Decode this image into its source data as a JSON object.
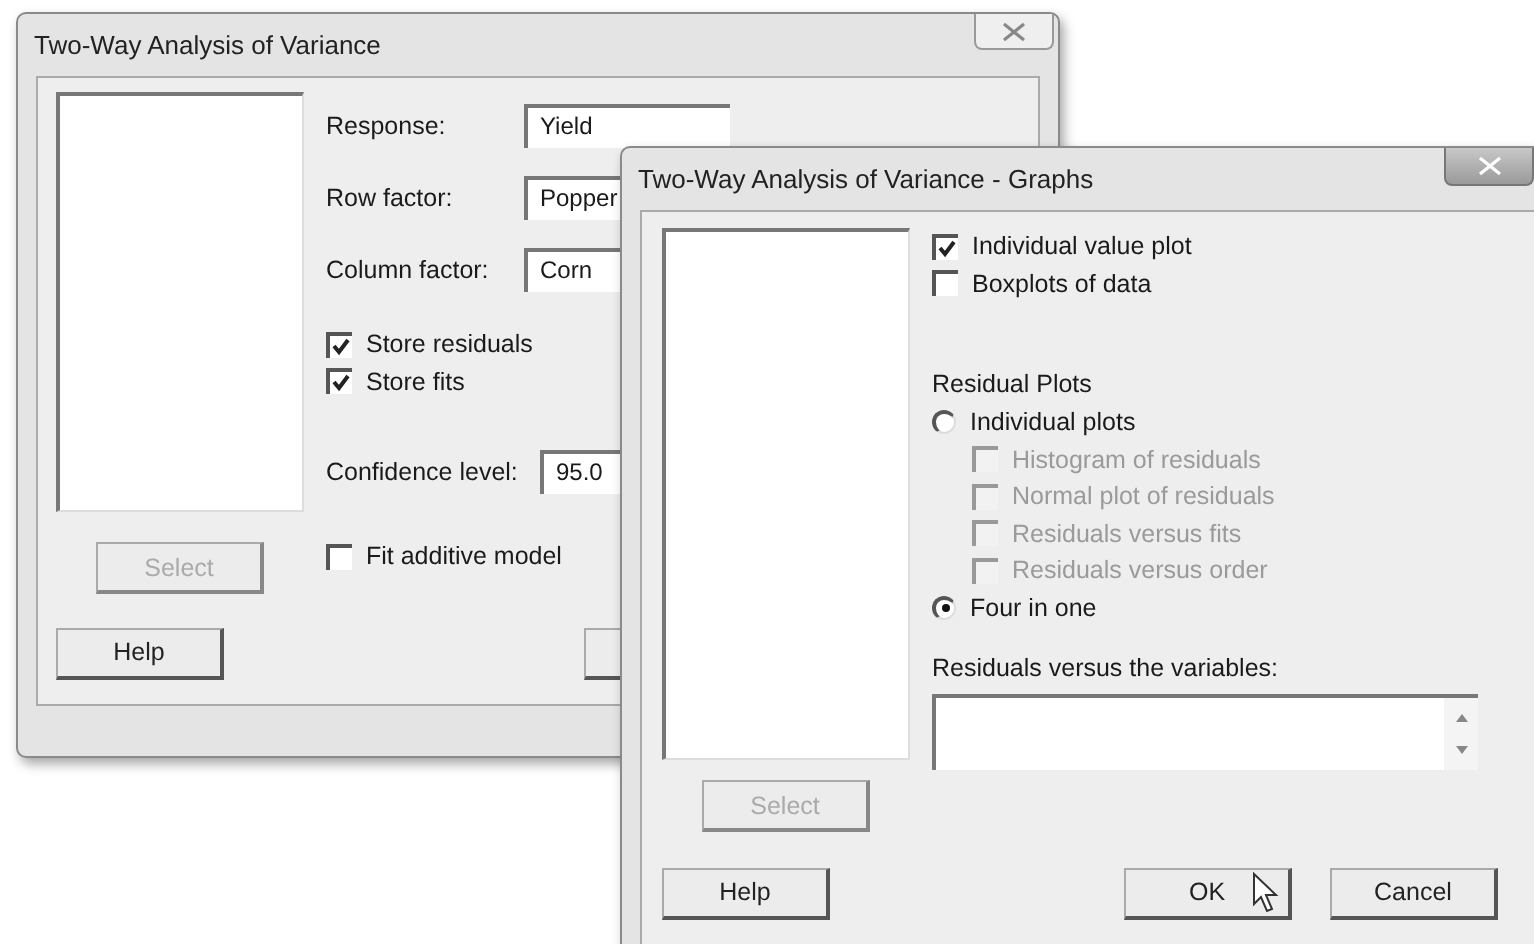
{
  "main_dialog": {
    "title": "Two-Way Analysis of Variance",
    "fields": [
      {
        "label": "Response:",
        "value": "Yield"
      },
      {
        "label": "Row factor:",
        "value": "Popper"
      },
      {
        "label": "Column factor:",
        "value": "Corn"
      }
    ],
    "store_options": [
      {
        "label": "Store residuals",
        "checked": true
      },
      {
        "label": "Store fits",
        "checked": true
      }
    ],
    "confidence": {
      "label": "Confidence level:",
      "value": "95.0"
    },
    "additive": {
      "label": "Fit additive model",
      "checked": false
    },
    "select_button": {
      "label": "Select",
      "disabled": true
    },
    "help_button": {
      "label": "Help"
    }
  },
  "graphs_dialog": {
    "title": "Two-Way Analysis of Variance - Graphs",
    "data_plots": [
      {
        "label": "Individual value plot",
        "checked": true
      },
      {
        "label": "Boxplots of data",
        "checked": false
      }
    ],
    "residual_plots": {
      "label": "Residual Plots",
      "choices": [
        {
          "label": "Individual plots",
          "selected": false,
          "options": [
            {
              "label": "Histogram of residuals",
              "checked": false,
              "disabled": true
            },
            {
              "label": "Normal plot of residuals",
              "checked": false,
              "disabled": true
            },
            {
              "label": "Residuals versus fits",
              "checked": false,
              "disabled": true
            },
            {
              "label": "Residuals versus order",
              "checked": false,
              "disabled": true
            }
          ]
        },
        {
          "label": "Four in one",
          "selected": true
        }
      ]
    },
    "variables_field": {
      "label": "Residuals versus the variables:"
    },
    "select_button": {
      "label": "Select",
      "disabled": true
    },
    "buttons": [
      {
        "label": "Help",
        "kind": "help"
      },
      {
        "label": "OK",
        "kind": "ok"
      },
      {
        "label": "Cancel",
        "kind": "cancel"
      }
    ]
  }
}
